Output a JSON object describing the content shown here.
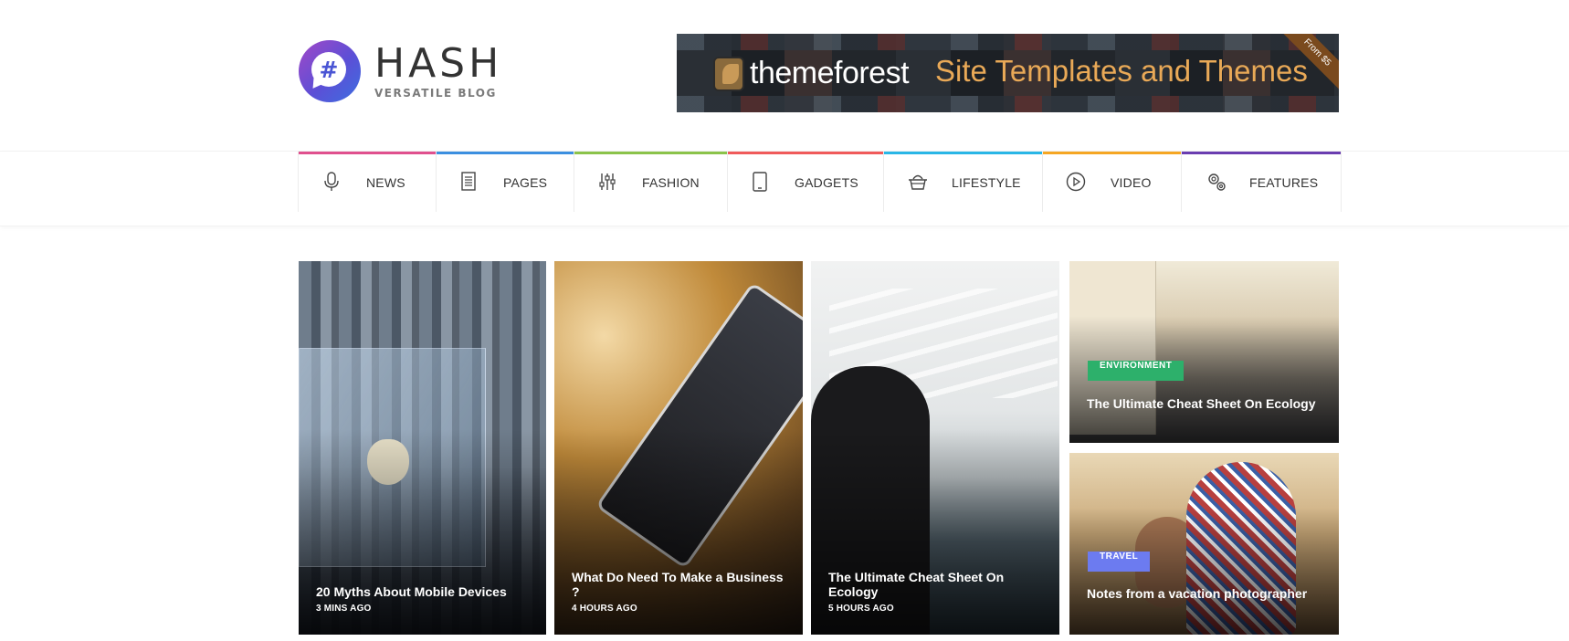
{
  "logo": {
    "title": "HASH",
    "subtitle": "VERSATILE BLOG",
    "badge_glyph": "#"
  },
  "banner": {
    "brand": "themeforest",
    "tagline": "Site Templates and Themes",
    "corner_text": "From $5"
  },
  "nav": {
    "items": [
      {
        "label": "NEWS",
        "icon": "microphone-icon",
        "color": "#e0508e"
      },
      {
        "label": "PAGES",
        "icon": "document-icon",
        "color": "#3b8fe0"
      },
      {
        "label": "FASHION",
        "icon": "sliders-icon",
        "color": "#8bc34a"
      },
      {
        "label": "GADGETS",
        "icon": "tablet-icon",
        "color": "#f05a5a"
      },
      {
        "label": "LIFESTYLE",
        "icon": "basket-icon",
        "color": "#29b6e6"
      },
      {
        "label": "VIDEO",
        "icon": "play-icon",
        "color": "#f5a623"
      },
      {
        "label": "FEATURES",
        "icon": "gears-icon",
        "color": "#6a3db0"
      }
    ]
  },
  "posts": [
    {
      "title": "20 Myths About Mobile Devices",
      "time": "3 MINS AGO"
    },
    {
      "title": "What Do Need To Make a Business ?",
      "time": "4 HOURS AGO"
    },
    {
      "title": "The Ultimate Cheat Sheet On Ecology",
      "time": "5 HOURS AGO"
    },
    {
      "title": "The Ultimate Cheat Sheet On Ecology",
      "category": "ENVIRONMENT",
      "category_color": "#2db06b"
    },
    {
      "title": "Notes from a vacation photographer",
      "category": "TRAVEL",
      "category_color": "#6c7bf0"
    }
  ]
}
